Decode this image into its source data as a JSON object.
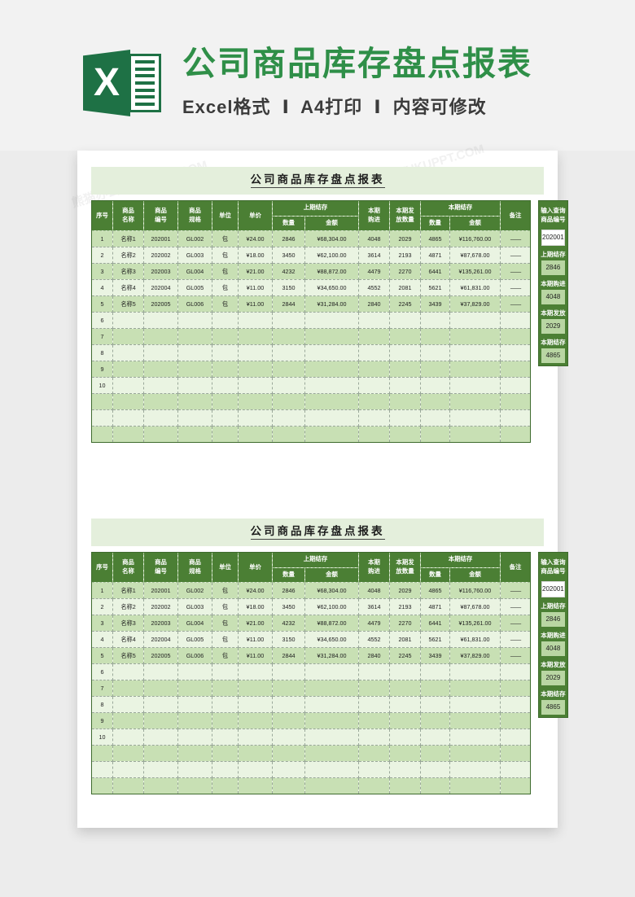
{
  "banner": {
    "logo_icon": "excel-logo-icon",
    "title": "公司商品库存盘点报表",
    "subtitle_parts": [
      "Excel格式",
      "A4打印",
      "内容可修改"
    ],
    "separator": "Ⅰ",
    "title_color": "#2f8f48"
  },
  "watermarks": [
    "熊猫办公 TUKUPPT.COM",
    "熊猫办公 TUKUPPT.COM",
    "熊猫办公 TUKUPPT.COM",
    "熊猫办公 TUKUPPT.COM",
    "熊猫办公 TUKUPPT.COM",
    "熊猫办公 TUKUPPT.COM"
  ],
  "report": {
    "title": "公司商品库存盘点报表",
    "header_color": "#4b7f34",
    "band_odd_color": "#c8e0b4",
    "band_even_color": "#eaf4e2",
    "columns": {
      "seq": "序号",
      "name": "商品\n名称",
      "name_l1": "商品",
      "name_l2": "名称",
      "code_l1": "商品",
      "code_l2": "编号",
      "spec_l1": "商品",
      "spec_l2": "规格",
      "unit": "单位",
      "price": "单价",
      "prev_group": "上期结存",
      "prev_qty": "数量",
      "prev_amt": "金额",
      "purchase_l1": "本期",
      "purchase_l2": "购进",
      "issue_l1": "本期发",
      "issue_l2": "放数量",
      "cur_group": "本期结存",
      "cur_qty": "数量",
      "cur_amt": "金额",
      "remark": "备注"
    },
    "rows": [
      {
        "seq": "1",
        "name": "名称1",
        "code": "202001",
        "spec": "GL002",
        "unit": "包",
        "price": "¥24.00",
        "prev_qty": "2846",
        "prev_amt": "¥68,304.00",
        "purchase": "4048",
        "issue": "2029",
        "cur_qty": "4865",
        "cur_amt": "¥116,760.00",
        "remark": "——"
      },
      {
        "seq": "2",
        "name": "名称2",
        "code": "202002",
        "spec": "GL003",
        "unit": "包",
        "price": "¥18.00",
        "prev_qty": "3450",
        "prev_amt": "¥62,100.00",
        "purchase": "3614",
        "issue": "2193",
        "cur_qty": "4871",
        "cur_amt": "¥87,678.00",
        "remark": "——"
      },
      {
        "seq": "3",
        "name": "名称3",
        "code": "202003",
        "spec": "GL004",
        "unit": "包",
        "price": "¥21.00",
        "prev_qty": "4232",
        "prev_amt": "¥88,872.00",
        "purchase": "4479",
        "issue": "2270",
        "cur_qty": "6441",
        "cur_amt": "¥135,261.00",
        "remark": "——"
      },
      {
        "seq": "4",
        "name": "名称4",
        "code": "202004",
        "spec": "GL005",
        "unit": "包",
        "price": "¥11.00",
        "prev_qty": "3150",
        "prev_amt": "¥34,650.00",
        "purchase": "4552",
        "issue": "2081",
        "cur_qty": "5621",
        "cur_amt": "¥61,831.00",
        "remark": "——"
      },
      {
        "seq": "5",
        "name": "名称5",
        "code": "202005",
        "spec": "GL006",
        "unit": "包",
        "price": "¥11.00",
        "prev_qty": "2844",
        "prev_amt": "¥31,284.00",
        "purchase": "2840",
        "issue": "2245",
        "cur_qty": "3439",
        "cur_amt": "¥37,829.00",
        "remark": "——"
      },
      {
        "seq": "6",
        "name": "",
        "code": "",
        "spec": "",
        "unit": "",
        "price": "",
        "prev_qty": "",
        "prev_amt": "",
        "purchase": "",
        "issue": "",
        "cur_qty": "",
        "cur_amt": "",
        "remark": ""
      },
      {
        "seq": "7",
        "name": "",
        "code": "",
        "spec": "",
        "unit": "",
        "price": "",
        "prev_qty": "",
        "prev_amt": "",
        "purchase": "",
        "issue": "",
        "cur_qty": "",
        "cur_amt": "",
        "remark": ""
      },
      {
        "seq": "8",
        "name": "",
        "code": "",
        "spec": "",
        "unit": "",
        "price": "",
        "prev_qty": "",
        "prev_amt": "",
        "purchase": "",
        "issue": "",
        "cur_qty": "",
        "cur_amt": "",
        "remark": ""
      },
      {
        "seq": "9",
        "name": "",
        "code": "",
        "spec": "",
        "unit": "",
        "price": "",
        "prev_qty": "",
        "prev_amt": "",
        "purchase": "",
        "issue": "",
        "cur_qty": "",
        "cur_amt": "",
        "remark": ""
      },
      {
        "seq": "10",
        "name": "",
        "code": "",
        "spec": "",
        "unit": "",
        "price": "",
        "prev_qty": "",
        "prev_amt": "",
        "purchase": "",
        "issue": "",
        "cur_qty": "",
        "cur_amt": "",
        "remark": ""
      },
      {
        "seq": "",
        "name": "",
        "code": "",
        "spec": "",
        "unit": "",
        "price": "",
        "prev_qty": "",
        "prev_amt": "",
        "purchase": "",
        "issue": "",
        "cur_qty": "",
        "cur_amt": "",
        "remark": ""
      },
      {
        "seq": "",
        "name": "",
        "code": "",
        "spec": "",
        "unit": "",
        "price": "",
        "prev_qty": "",
        "prev_amt": "",
        "purchase": "",
        "issue": "",
        "cur_qty": "",
        "cur_amt": "",
        "remark": ""
      },
      {
        "seq": "",
        "name": "",
        "code": "",
        "spec": "",
        "unit": "",
        "price": "",
        "prev_qty": "",
        "prev_amt": "",
        "purchase": "",
        "issue": "",
        "cur_qty": "",
        "cur_amt": "",
        "remark": ""
      }
    ],
    "query_panel": {
      "head_l1": "输入查询",
      "head_l2": "商品编号",
      "input_value": "202001",
      "fields": [
        {
          "label": "上期结存",
          "value": "2846"
        },
        {
          "label": "本期购进",
          "value": "4048"
        },
        {
          "label": "本期发放",
          "value": "2029"
        },
        {
          "label": "本期结存",
          "value": "4865"
        }
      ]
    }
  }
}
